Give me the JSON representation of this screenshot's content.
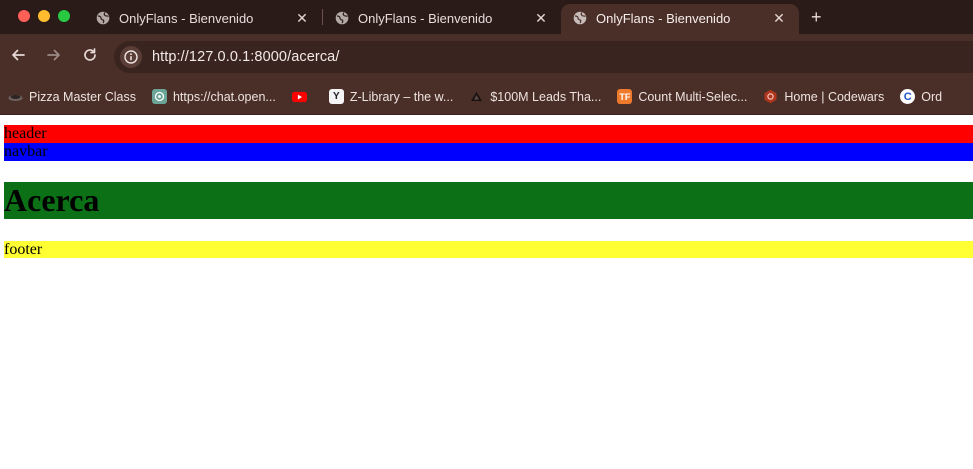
{
  "browser": {
    "tabs": [
      {
        "title": "OnlyFlans - Bienvenido",
        "active": false
      },
      {
        "title": "OnlyFlans - Bienvenido",
        "active": false
      },
      {
        "title": "OnlyFlans - Bienvenido",
        "active": true
      }
    ],
    "close_glyph": "✕",
    "new_tab_glyph": "+",
    "url": "http://127.0.0.1:8000/acerca/",
    "bookmarks": [
      {
        "label": "Pizza Master Class",
        "icon": "pizza-icon"
      },
      {
        "label": "https://chat.open...",
        "icon": "chatgpt-icon"
      },
      {
        "label": "",
        "icon": "youtube-icon"
      },
      {
        "label": "Z-Library – the w...",
        "icon": "zlibrary-icon"
      },
      {
        "label": "$100M Leads Tha...",
        "icon": "triangle-icon"
      },
      {
        "label": "Count Multi-Selec...",
        "icon": "tf-icon"
      },
      {
        "label": "Home | Codewars",
        "icon": "codewars-icon"
      },
      {
        "label": "Ord",
        "icon": "c-icon"
      }
    ]
  },
  "page": {
    "header": "header",
    "navbar": "navbar",
    "heading": "Acerca",
    "footer": "footer"
  },
  "colors": {
    "header_bg": "#ff0000",
    "navbar_bg": "#0000ff",
    "main_bg": "#0c7017",
    "footer_bg": "#ffff33"
  }
}
